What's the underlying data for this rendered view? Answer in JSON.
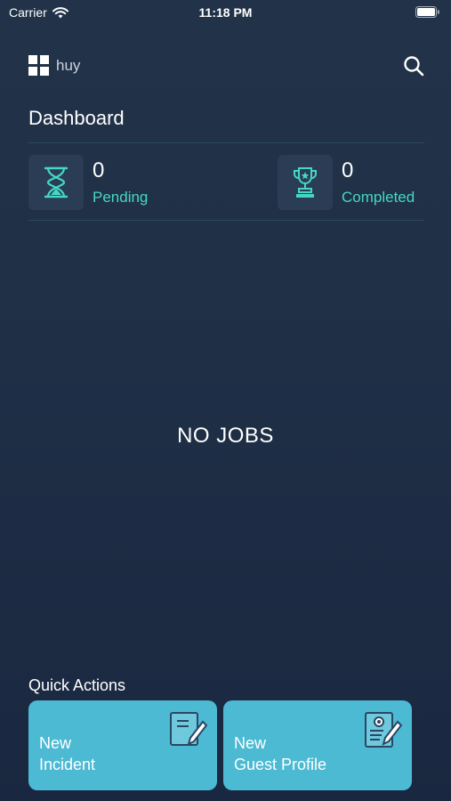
{
  "status_bar": {
    "carrier": "Carrier",
    "time": "11:18 PM",
    "icons": [
      "wifi-icon",
      "battery-icon"
    ]
  },
  "header": {
    "username": "huy",
    "menu_icon": "grid-icon",
    "search_icon": "search-icon"
  },
  "page_title": "Dashboard",
  "stats": {
    "pending": {
      "count": "0",
      "label": "Pending",
      "icon": "hourglass-icon"
    },
    "completed": {
      "count": "0",
      "label": "Completed",
      "icon": "trophy-icon"
    }
  },
  "empty_state": "NO JOBS",
  "quick_actions": {
    "title": "Quick Actions",
    "items": [
      {
        "line1": "New",
        "line2": "Incident",
        "icon": "note-edit-icon"
      },
      {
        "line1": "New",
        "line2": "Guest Profile",
        "icon": "profile-edit-icon"
      }
    ]
  },
  "colors": {
    "background": "#1f2f46",
    "accent_teal": "#46d7c4",
    "card_blue": "#4dbad4",
    "stat_icon_bg": "#2a3d55"
  }
}
